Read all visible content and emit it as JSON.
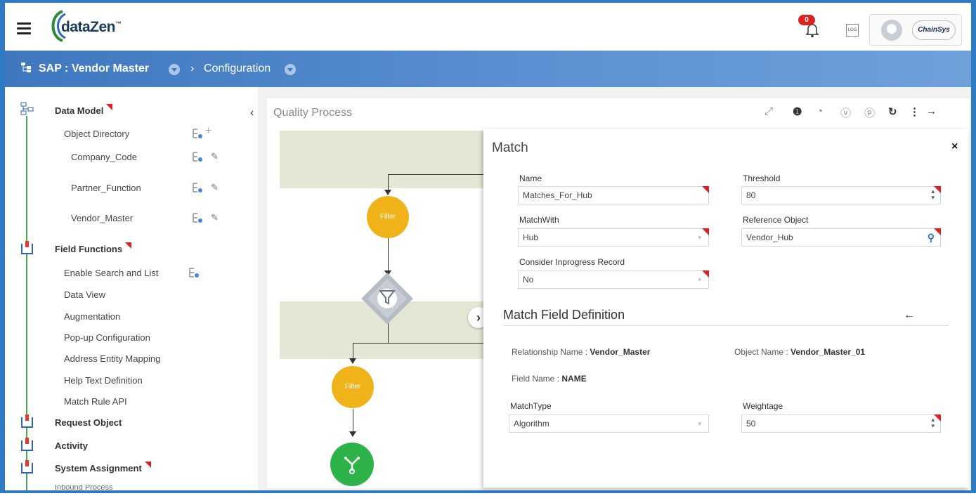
{
  "header": {
    "logo_text": "dataZen",
    "logo_tm": "™",
    "notification_count": "0",
    "log_label": "LOG",
    "brand_label": "ChainSys"
  },
  "breadcrumb": {
    "project": "SAP : Vendor Master",
    "separator": "›",
    "section": "Configuration"
  },
  "sidebar": {
    "data_model": "Data Model",
    "object_directory": "Object Directory",
    "objects": [
      "Company_Code",
      "Partner_Function",
      "Vendor_Master"
    ],
    "field_functions": "Field Functions",
    "field_items": [
      "Enable Search and List",
      "Data View",
      "Augmentation",
      "Pop-up Configuration",
      "Address Entity Mapping",
      "Help Text Definition",
      "Match Rule API"
    ],
    "request_object": "Request Object",
    "activity": "Activity",
    "system_assignment": "System Assignment",
    "inbound_process": "Inbound Process"
  },
  "canvas": {
    "title": "Quality Process",
    "collapse_glyph": "‹",
    "filter1": "Filter",
    "filter2": "Filter",
    "expand_glyph": "›"
  },
  "match_panel": {
    "title": "Match",
    "close": "×",
    "name_label": "Name",
    "name_value": "Matches_For_Hub",
    "threshold_label": "Threshold",
    "threshold_value": "80",
    "matchwith_label": "MatchWith",
    "matchwith_value": "Hub",
    "refobj_label": "Reference Object",
    "refobj_value": "Vendor_Hub",
    "inprogress_label": "Consider Inprogress Record",
    "inprogress_value": "No",
    "section_title": "Match Field Definition",
    "back_glyph": "←",
    "relationship_key": "Relationship Name : ",
    "relationship_val": "Vendor_Master",
    "object_key": "Object Name : ",
    "object_val": "Vendor_Master_01",
    "field_key": "Field Name : ",
    "field_val": "NAME",
    "matchtype_label": "MatchType",
    "matchtype_value": "Algorithm",
    "weightage_label": "Weightage",
    "weightage_value": "50"
  },
  "colors": {
    "brand_blue": "#3f78bf",
    "filter_yellow": "#f0b31a",
    "start_green": "#2db34a",
    "flag_red": "#e02020"
  }
}
